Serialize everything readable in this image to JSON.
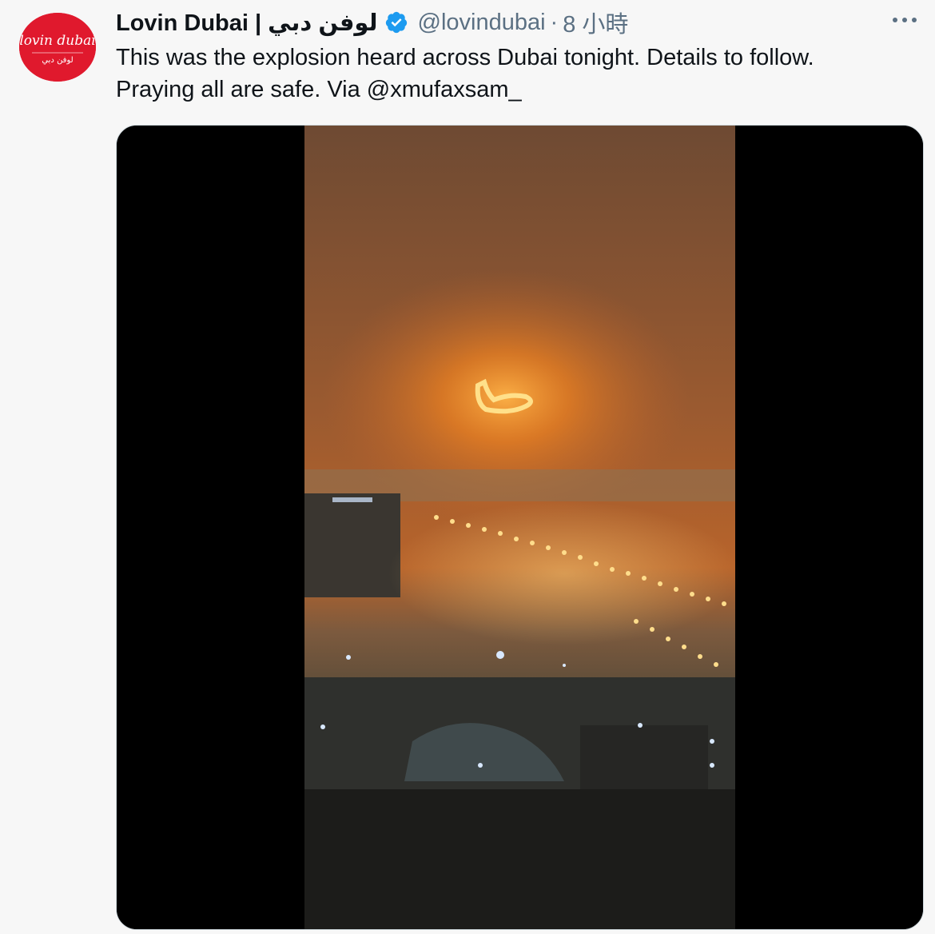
{
  "tweet": {
    "display_name": "Lovin Dubai | لوفن دبي",
    "handle": "@lovindubai",
    "separator": "·",
    "time": "8 小時",
    "text_line1": "This was the explosion heard across Dubai tonight. Details to follow.",
    "text_line2": "Praying all are safe. Via @xmufaxsam_"
  },
  "avatar": {
    "logo_text": "lovin dubai",
    "logo_subtext": "لوفن دبي"
  },
  "icons": {
    "verified": "verified-badge-icon",
    "more": "more-options-icon"
  },
  "colors": {
    "avatar_bg": "#e0192d",
    "verified": "#1d9bf0",
    "muted_text": "#5b7083",
    "explosion": "#ff8a1e"
  }
}
